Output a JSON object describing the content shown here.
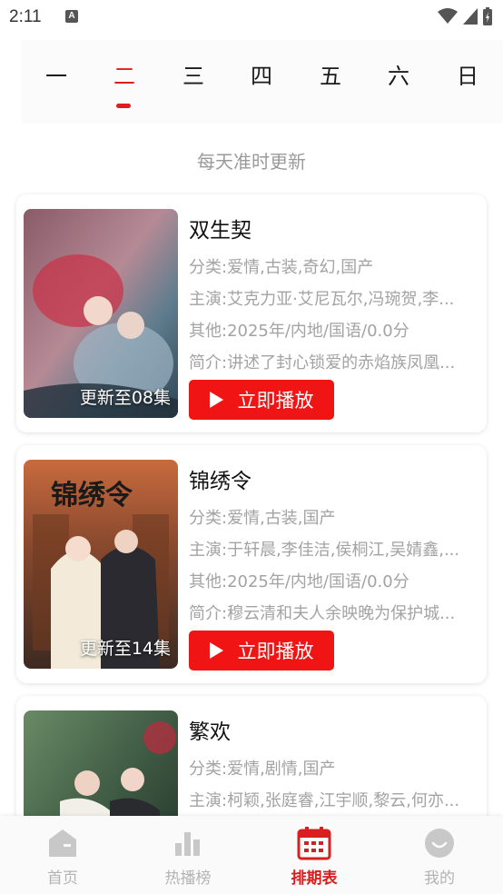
{
  "status_bar": {
    "time": "2:11",
    "notification_icon": "A"
  },
  "day_tabs": {
    "items": [
      "一",
      "二",
      "三",
      "四",
      "五",
      "六",
      "日"
    ],
    "active_index": 1
  },
  "subtitle": "每天准时更新",
  "colors": {
    "accent": "#e01d1d",
    "play_button": "#f01414",
    "muted_text": "#a3a3a3"
  },
  "cards": [
    {
      "title": "双生契",
      "category": "分类:爱情,古装,奇幻,国产",
      "cast": "主演:艾克力亚·艾尼瓦尔,冯琬贺,李...",
      "other": "其他:2025年/内地/国语/0.0分",
      "intro": "简介:讲述了封心锁爱的赤焰族凤凰...",
      "badge": "更新至08集",
      "play_label": "立即播放"
    },
    {
      "title": "锦绣令",
      "category": "分类:爱情,古装,国产",
      "cast": "主演:于轩晨,李佳洁,侯桐江,吴婧鑫,...",
      "other": "其他:2025年/内地/国语/0.0分",
      "intro": "简介:穆云清和夫人余映晚为保护城...",
      "badge": "更新至14集",
      "play_label": "立即播放",
      "poster_text": "锦绣令"
    },
    {
      "title": "繁欢",
      "category": "分类:爱情,剧情,国产",
      "cast": "主演:柯颖,张庭睿,江宇顺,黎云,何亦..."
    }
  ],
  "bottom_nav": {
    "items": [
      {
        "label": "首页",
        "icon": "home-icon"
      },
      {
        "label": "热播榜",
        "icon": "bar-chart-icon"
      },
      {
        "label": "排期表",
        "icon": "calendar-icon"
      },
      {
        "label": "我的",
        "icon": "profile-icon"
      }
    ],
    "active_index": 2
  }
}
